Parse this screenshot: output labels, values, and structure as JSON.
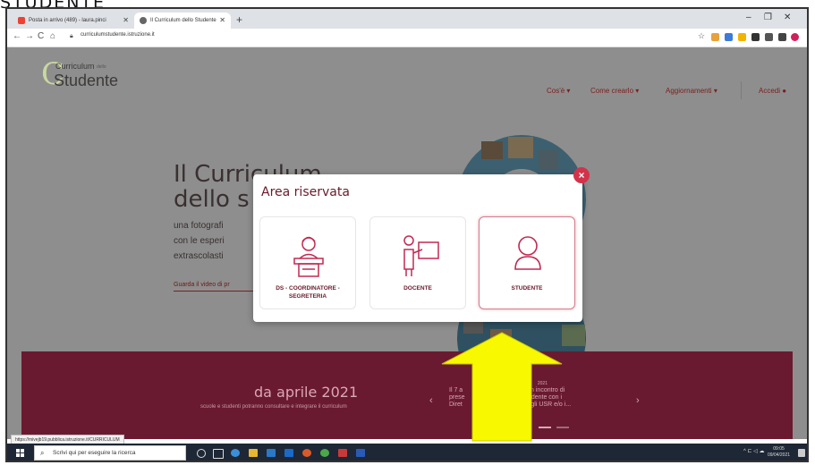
{
  "heading_fragment": "STUDENTE",
  "browser": {
    "tabs": [
      {
        "label": "Posta in arrivo (489) - laura.pinci"
      },
      {
        "label": "Il Curriculum dello Studente"
      }
    ],
    "url": "curriculumstudente.istruzione.it"
  },
  "site": {
    "logo_top": "Curriculum",
    "logo_small": "dello",
    "logo_bottom": "Studente",
    "nav": [
      "Cos'è",
      "Come crearlo",
      "Aggiornamenti",
      "Accedi"
    ],
    "hero_title_1": "Il Curriculum",
    "hero_title_2": "dello s",
    "hero_lines": [
      "una fotografi",
      "con le esperi",
      "extrascolasti"
    ],
    "video_link": "Guarda il video di pr",
    "banner_title": "da aprile 2021",
    "banner_subtitle": "scuole e studenti potranno consultare e integrare il curriculum",
    "news_date": "2021",
    "news_lines": [
      "Il 7 a                    00 si terrà un incontro di",
      "prese                  lum dello studente con i",
      "Diret                    nti titolari degli USR e/o i..."
    ]
  },
  "modal": {
    "title": "Area riservata",
    "close_label": "×",
    "cards": [
      {
        "line1": "DS - COORDINATORE -",
        "line2": "SEGRETERIA",
        "icon": "desk-person-icon"
      },
      {
        "line1": "DOCENTE",
        "line2": "",
        "icon": "teacher-board-icon"
      },
      {
        "line1": "STUDENTE",
        "line2": "",
        "icon": "student-person-icon"
      }
    ]
  },
  "status_url": "https://mivejb19.pubblica.istruzione.it/CURRICULUM",
  "taskbar": {
    "search_placeholder": "Scrivi qui per eseguire la ricerca",
    "time": "09:05",
    "date": "09/04/2021"
  },
  "colors": {
    "accent": "#6a1a2a",
    "close": "#d4324a",
    "arrow": "#f8f800",
    "banner": "#6a1a30"
  }
}
